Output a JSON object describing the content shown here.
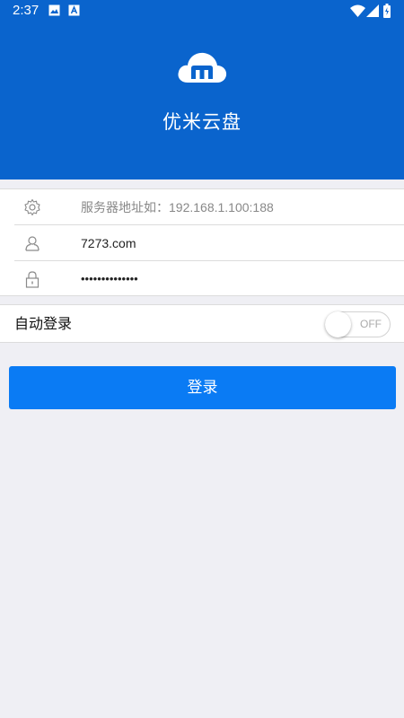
{
  "status_bar": {
    "time": "2:37",
    "left_icons": [
      "image-notification-icon",
      "app-notification-icon"
    ],
    "right_icons": [
      "wifi-icon",
      "signal-icon",
      "battery-icon"
    ]
  },
  "header": {
    "logo_icon": "cloud-logo-icon",
    "title": "优米云盘",
    "background_color": "#0a64cd"
  },
  "form": {
    "server": {
      "icon": "gear-icon",
      "value": "",
      "placeholder": "服务器地址如：192.168.1.100:188"
    },
    "username": {
      "icon": "user-icon",
      "value": "7273.com"
    },
    "password": {
      "icon": "lock-icon",
      "value": "••••••••••••••"
    }
  },
  "auto_login": {
    "label": "自动登录",
    "toggle_state": "OFF"
  },
  "login_button": {
    "label": "登录",
    "color": "#0a7bf4"
  }
}
